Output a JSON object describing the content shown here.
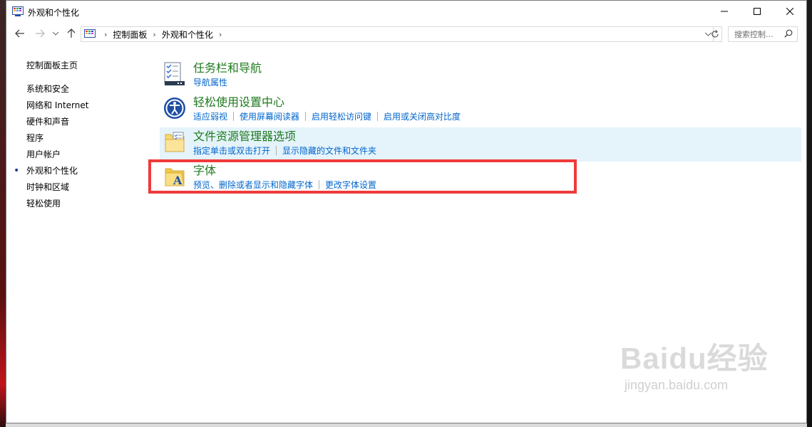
{
  "window": {
    "title": "外观和个性化"
  },
  "breadcrumb": {
    "root": "控制面板",
    "current": "外观和个性化"
  },
  "search": {
    "placeholder": "搜索控制..."
  },
  "sidebar": {
    "home": "控制面板主页",
    "items": [
      {
        "label": "系统和安全"
      },
      {
        "label": "网络和 Internet"
      },
      {
        "label": "硬件和声音"
      },
      {
        "label": "程序"
      },
      {
        "label": "用户帐户"
      },
      {
        "label": "外观和个性化",
        "current": true
      },
      {
        "label": "时钟和区域"
      },
      {
        "label": "轻松使用"
      }
    ]
  },
  "categories": [
    {
      "title": "任务栏和导航",
      "links": [
        "导航属性"
      ],
      "icon": "taskbar-icon"
    },
    {
      "title": "轻松使用设置中心",
      "links": [
        "适应弱视",
        "使用屏幕阅读器",
        "启用轻松访问键",
        "启用或关闭高对比度"
      ],
      "icon": "ease-of-access-icon"
    },
    {
      "title": "文件资源管理器选项",
      "links": [
        "指定单击或双击打开",
        "显示隐藏的文件和文件夹"
      ],
      "icon": "folder-options-icon"
    },
    {
      "title": "字体",
      "links": [
        "预览、删除或者显示和隐藏字体",
        "更改字体设置"
      ],
      "icon": "fonts-folder-icon"
    }
  ],
  "watermark": {
    "logo": "Baidu经验",
    "url": "jingyan.baidu.com"
  },
  "colors": {
    "category_title": "#1e7a1e",
    "link": "#0066cc",
    "highlight_border": "#f03a3a",
    "hover_bg": "#e5f3fb"
  }
}
